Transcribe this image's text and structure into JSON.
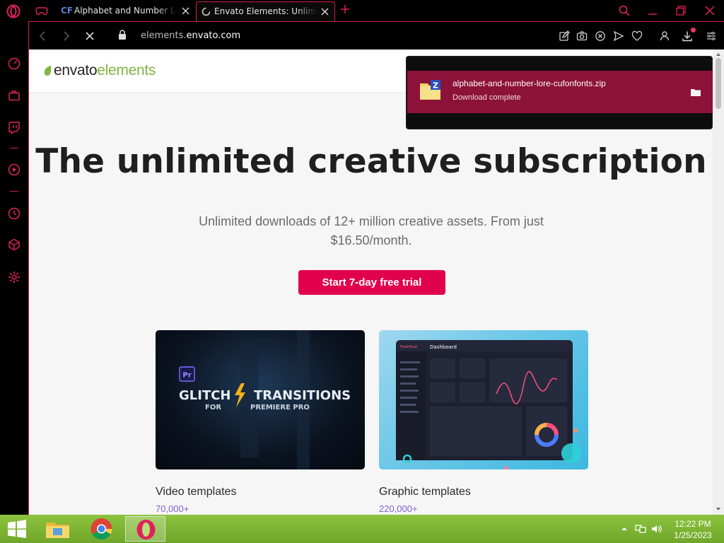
{
  "browser": {
    "tabs": [
      {
        "favicon_text": "CF",
        "title": "Alphabet and Number Lore"
      },
      {
        "title": "Envato Elements: Unlimited"
      }
    ],
    "url": {
      "prefix": "elements.",
      "domain": "envato.com"
    }
  },
  "page": {
    "logo": {
      "word1": "envato",
      "word2": "elements"
    },
    "hero_title": "The unlimited creative subscription",
    "subtitle": "Unlimited downloads of 12+ million creative assets. From just $16.50/month.",
    "cta_label": "Start 7-day free trial",
    "cards": [
      {
        "title": "Video templates",
        "count": "70,000+",
        "thumb": {
          "badge": "Pr",
          "line1a": "GLITCH",
          "line1b": "TRANSITIONS",
          "line2a": "FOR",
          "line2b": "PREMIERE PRO"
        }
      },
      {
        "title": "Graphic templates",
        "count": "220,000+",
        "thumb": {
          "brand": "Freshfloat",
          "heading": "Dashboard"
        }
      }
    ]
  },
  "download": {
    "filename": "alphabet-and-number-lore-cufonfonts.zip",
    "status": "Download complete"
  },
  "taskbar": {
    "time": "12:22 PM",
    "date": "1/25/2023"
  },
  "colors": {
    "opera_red": "#e0225a",
    "cta": "#e1004c",
    "envato_green": "#82b541",
    "download_bg": "#8c1239",
    "count_purple": "#7b63d6"
  }
}
